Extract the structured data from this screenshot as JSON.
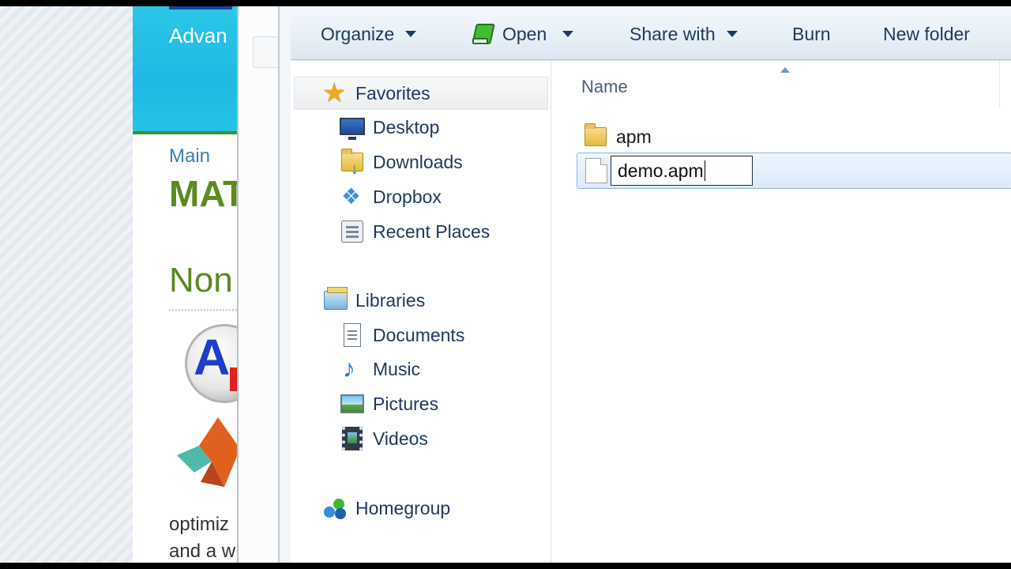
{
  "web_page": {
    "banner_text": "Advan",
    "main_link": "Main",
    "title": "MAT",
    "heading": "Non",
    "body_line1": "optimiz",
    "body_line2": "and a w"
  },
  "toolbar": {
    "organize": "Organize",
    "open": "Open",
    "share_with": "Share with",
    "burn": "Burn",
    "new_folder": "New folder"
  },
  "nav": {
    "favorites": "Favorites",
    "desktop": "Desktop",
    "downloads": "Downloads",
    "dropbox": "Dropbox",
    "recent_places": "Recent Places",
    "libraries": "Libraries",
    "documents": "Documents",
    "music": "Music",
    "pictures": "Pictures",
    "videos": "Videos",
    "homegroup": "Homegroup"
  },
  "content": {
    "column_name": "Name",
    "items": [
      {
        "name": "apm",
        "type": "folder"
      },
      {
        "name": "demo.apm",
        "type": "file",
        "renaming": true
      }
    ]
  },
  "colors": {
    "banner": "#1fb9e3",
    "title_green": "#5b8a1e",
    "nav_text": "#1e395b",
    "selection": "#d9eafb"
  }
}
